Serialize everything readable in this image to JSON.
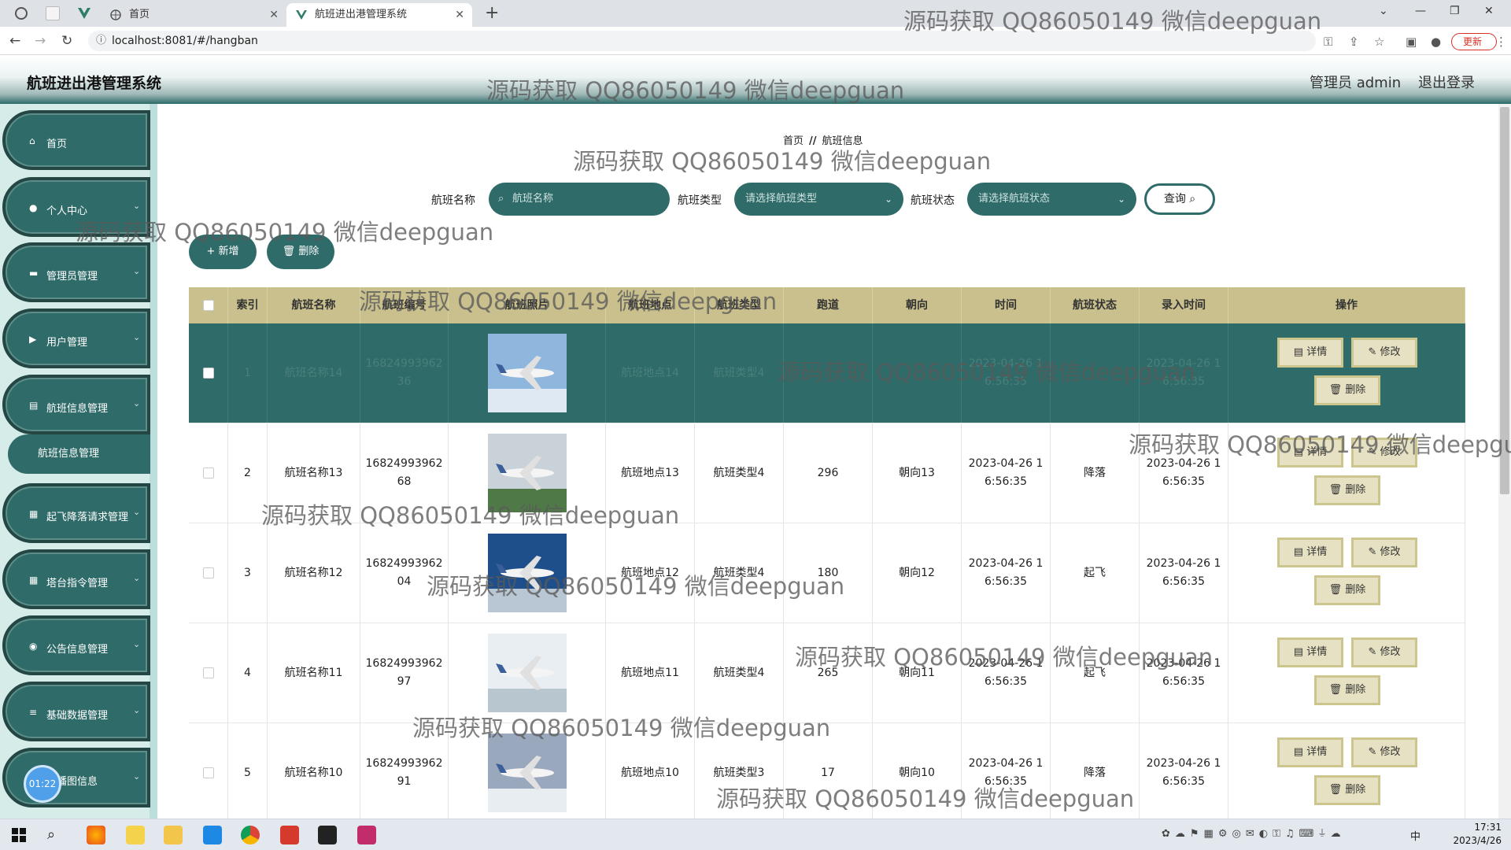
{
  "browser": {
    "tab1_title": "首页",
    "tab2_title": "航班进出港管理系统",
    "url": "localhost:8081/#/hangban",
    "update_label": "更新"
  },
  "header": {
    "title": "航班进出港管理系统",
    "admin": "管理员 admin",
    "logout": "退出登录"
  },
  "sidebar": {
    "items": [
      {
        "label": "首页",
        "icon": "home-icon"
      },
      {
        "label": "个人中心",
        "icon": "user-icon"
      },
      {
        "label": "管理员管理",
        "icon": "chat-icon"
      },
      {
        "label": "用户管理",
        "icon": "video-icon"
      },
      {
        "label": "航班信息管理",
        "icon": "document-icon"
      },
      {
        "label": "起飞降落请求管理",
        "icon": "grid-icon"
      },
      {
        "label": "塔台指令管理",
        "icon": "grid-icon"
      },
      {
        "label": "公告信息管理",
        "icon": "location-icon"
      },
      {
        "label": "基础数据管理",
        "icon": "menu-icon"
      },
      {
        "label": "轮播图信息",
        "icon": "picture-icon"
      }
    ],
    "sub_item": "航班信息管理",
    "timer": "01:22"
  },
  "breadcrumb": {
    "home": "首页",
    "sep": "//",
    "current": "航班信息"
  },
  "filters": {
    "name_label": "航班名称",
    "name_placeholder": "航班名称",
    "type_label": "航班类型",
    "type_placeholder": "请选择航班类型",
    "status_label": "航班状态",
    "status_placeholder": "请选择航班状态",
    "search_label": "查询"
  },
  "actions": {
    "add": "新增",
    "delete": "删除"
  },
  "table": {
    "headers": [
      "索引",
      "航班名称",
      "航班编号",
      "航班照片",
      "航班地点",
      "航班类型",
      "跑道",
      "朝向",
      "时间",
      "航班状态",
      "录入时间",
      "操作"
    ],
    "rows": [
      {
        "index": "1",
        "name": "航班名称14",
        "code": "1682499396236",
        "place": "航班地点14",
        "type": "航班类型4",
        "runway": "",
        "direction": "",
        "time": "2023-04-26 16:56:35",
        "status": "",
        "created": "2023-04-26 16:56:35",
        "photo": "plane-1"
      },
      {
        "index": "2",
        "name": "航班名称13",
        "code": "1682499396268",
        "place": "航班地点13",
        "type": "航班类型4",
        "runway": "296",
        "direction": "朝向13",
        "time": "2023-04-26 16:56:35",
        "status": "降落",
        "created": "2023-04-26 16:56:35",
        "photo": "plane-2"
      },
      {
        "index": "3",
        "name": "航班名称12",
        "code": "1682499396204",
        "place": "航班地点12",
        "type": "航班类型4",
        "runway": "180",
        "direction": "朝向12",
        "time": "2023-04-26 16:56:35",
        "status": "起飞",
        "created": "2023-04-26 16:56:35",
        "photo": "plane-3"
      },
      {
        "index": "4",
        "name": "航班名称11",
        "code": "1682499396297",
        "place": "航班地点11",
        "type": "航班类型4",
        "runway": "265",
        "direction": "朝向11",
        "time": "2023-04-26 16:56:35",
        "status": "起飞",
        "created": "2023-04-26 16:56:35",
        "photo": "plane-4"
      },
      {
        "index": "5",
        "name": "航班名称10",
        "code": "1682499396291",
        "place": "航班地点10",
        "type": "航班类型3",
        "runway": "17",
        "direction": "朝向10",
        "time": "2023-04-26 16:56:35",
        "status": "降落",
        "created": "2023-04-26 16:56:35",
        "photo": "plane-5"
      }
    ],
    "op_detail": "详情",
    "op_edit": "修改",
    "op_delete": "删除"
  },
  "watermark": "源码获取 QQ86050149 微信deepguan",
  "taskbar": {
    "time": "17:31",
    "date": "2023/4/26",
    "ime": "中"
  },
  "colors": {
    "primary": "#2f6b68",
    "header_row": "#c9c08d",
    "op_button": "#e6e1c2"
  }
}
